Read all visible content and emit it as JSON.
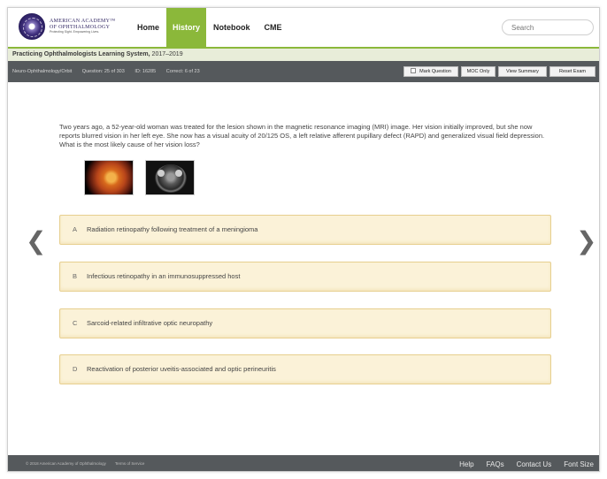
{
  "logo": {
    "line1": "AMERICAN ACADEMY™",
    "line2": "OF OPHTHALMOLOGY",
    "tagline": "Protecting Sight. Empowering Lives."
  },
  "nav": {
    "items": [
      "Home",
      "History",
      "Notebook",
      "CME"
    ],
    "active": "History"
  },
  "search": {
    "placeholder": "Search"
  },
  "subhead": {
    "title": "Practicing Ophthalmologists Learning System,",
    "years": "2017–2019"
  },
  "toolbar": {
    "section": "Neuro-Ophthalmology/Orbit",
    "question": "Question: 25 of 303",
    "id": "ID: 16285",
    "correct": "Correct: 6 of 23",
    "buttons": {
      "mark": "Mark Question",
      "moc": "MOC Only",
      "summary": "View Summary",
      "reset": "Reset Exam"
    }
  },
  "question": {
    "text": "Two years ago, a 52-year-old woman was treated for the lesion shown in the magnetic resonance imaging (MRI) image. Her vision initially improved, but she now reports blurred vision in her left eye. She now has a visual acuity of 20/125 OS, a left relative afferent pupillary defect (RAPD) and generalized visual field depression. What is the most likely cause of her vision loss?"
  },
  "answers": [
    {
      "letter": "A",
      "text": "Radiation retinopathy following treatment of a meningioma"
    },
    {
      "letter": "B",
      "text": "Infectious retinopathy in an immunosuppressed host"
    },
    {
      "letter": "C",
      "text": "Sarcoid-related infiltrative optic neuropathy"
    },
    {
      "letter": "D",
      "text": "Reactivation of posterior uveitis-associated and optic perineuritis"
    }
  ],
  "arrows": {
    "prev": "❮",
    "next": "❯"
  },
  "footer": {
    "copyright": "© 2018 American Academy of Ophthalmology",
    "terms": "Terms of Service",
    "links": [
      "Help",
      "FAQs",
      "Contact Us",
      "Font Size"
    ]
  },
  "colors": {
    "accent": "#8bb83a",
    "toolbar": "#55595c",
    "answer_bg": "#fbf2d8",
    "answer_border": "#e7cf8f"
  }
}
